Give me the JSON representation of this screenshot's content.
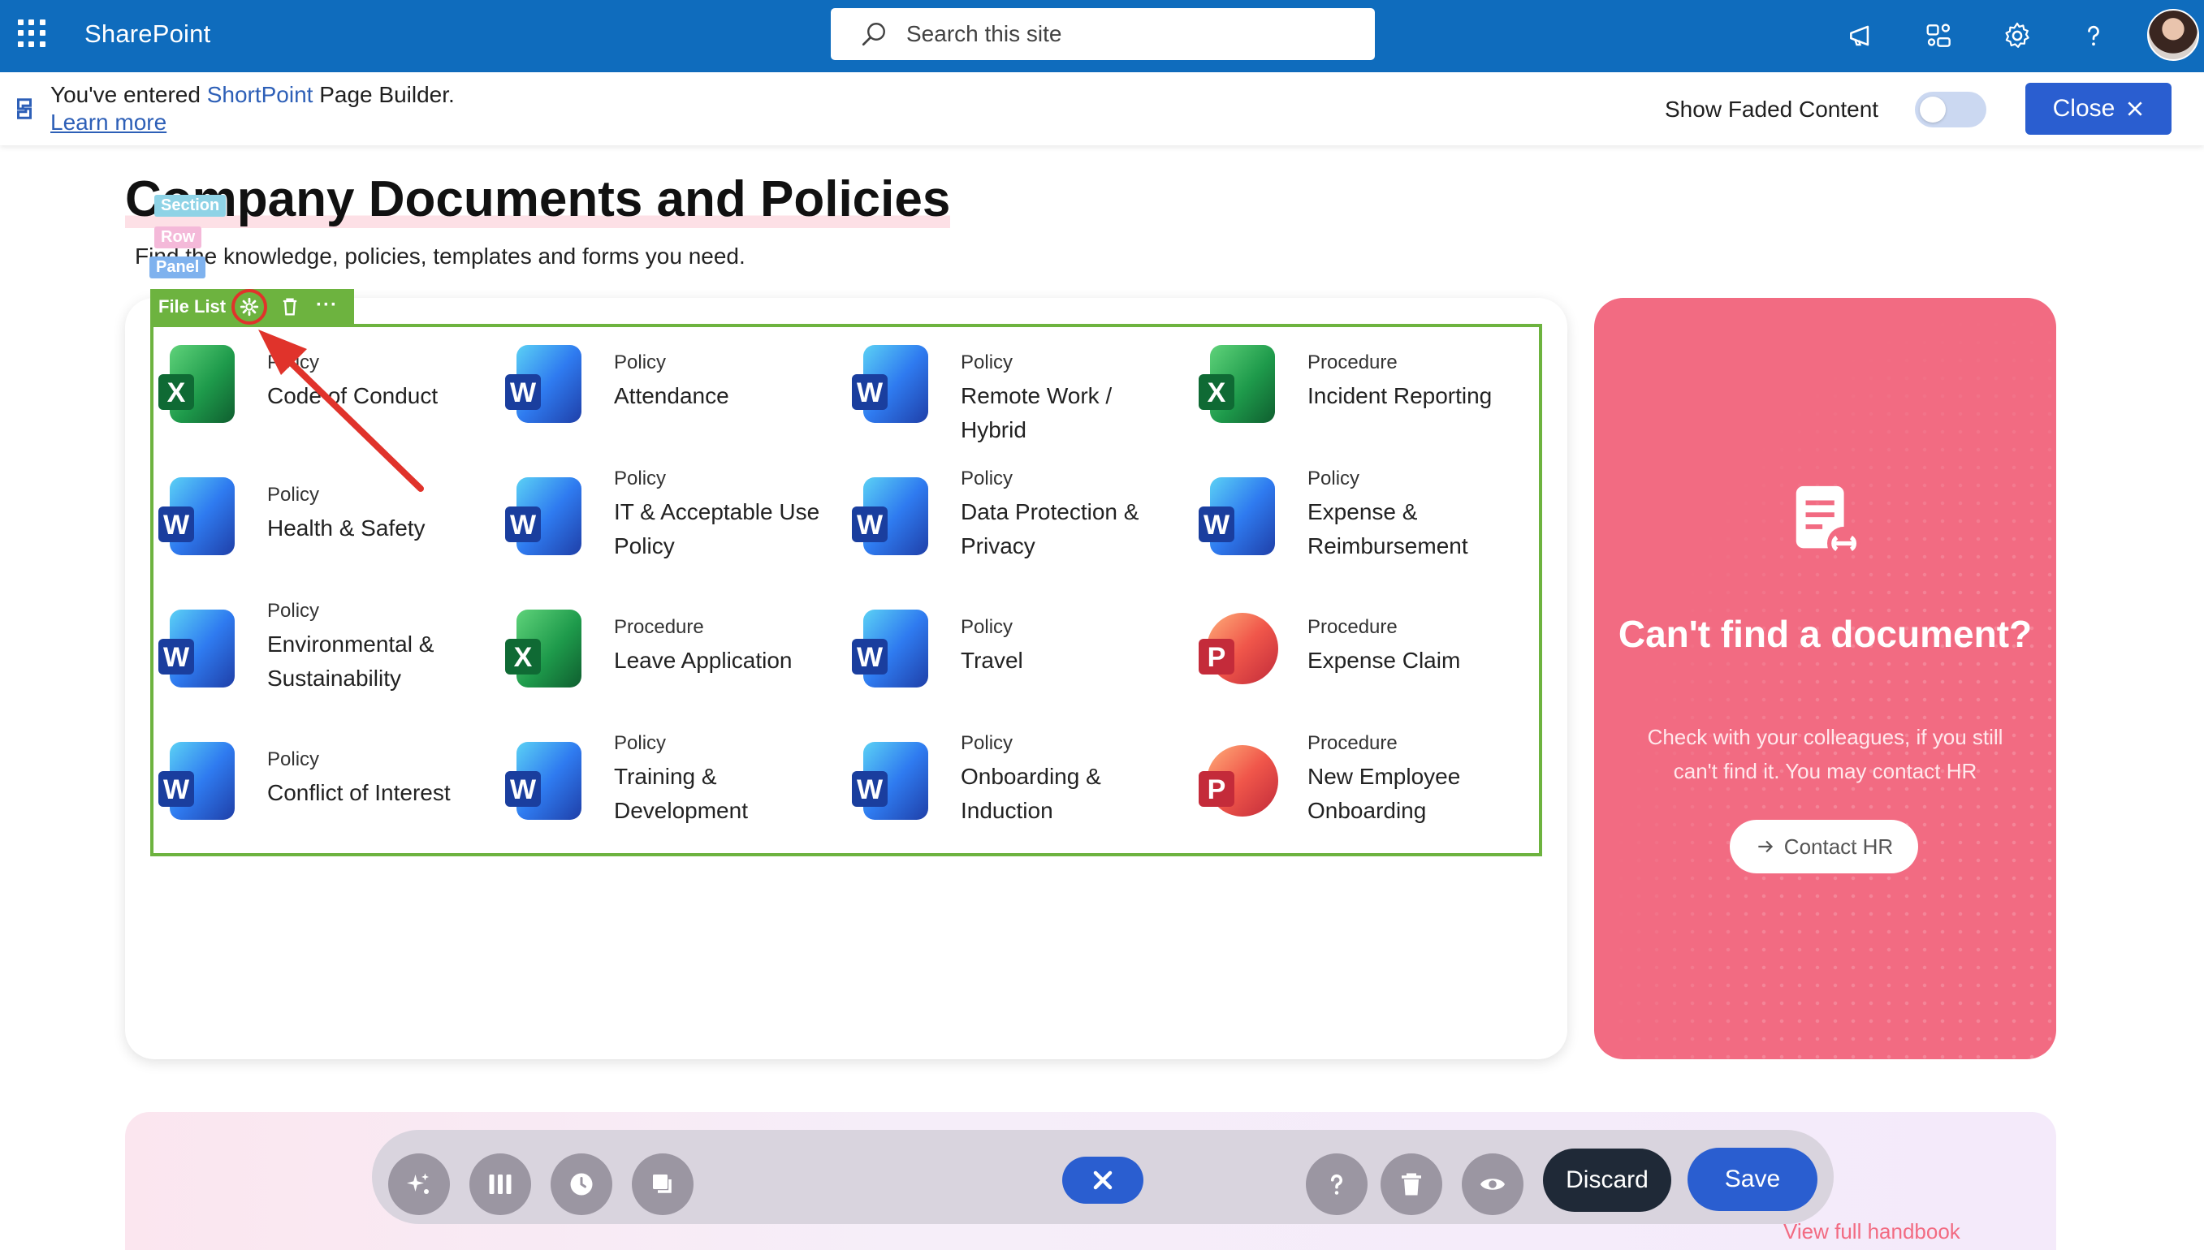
{
  "suite": {
    "app_name": "SharePoint",
    "search_placeholder": "Search this site"
  },
  "notice": {
    "prefix": "You've entered ",
    "product": "ShortPoint",
    "suffix": " Page Builder.",
    "learn_more": "Learn more",
    "faded_label": "Show Faded Content",
    "faded_on": false,
    "close_label": "Close"
  },
  "page": {
    "title": "Company Documents and Policies",
    "subtitle": "Find the knowledge, policies, templates and forms you need.",
    "chips": {
      "section": "Section",
      "row": "Row",
      "panel": "Panel"
    }
  },
  "file_list": {
    "toolbar_label": "File List",
    "documents": [
      {
        "category": "Policy",
        "name": "Code of Conduct",
        "type": "excel"
      },
      {
        "category": "Policy",
        "name": "Attendance",
        "type": "word"
      },
      {
        "category": "Policy",
        "name": "Remote Work / Hybrid",
        "type": "word"
      },
      {
        "category": "Procedure",
        "name": "Incident Reporting",
        "type": "excel"
      },
      {
        "category": "Policy",
        "name": "Health & Safety",
        "type": "word"
      },
      {
        "category": "Policy",
        "name": "IT & Acceptable Use Policy",
        "type": "word"
      },
      {
        "category": "Policy",
        "name": "Data Protection & Privacy",
        "type": "word"
      },
      {
        "category": "Policy",
        "name": "Expense & Reimbursement",
        "type": "word"
      },
      {
        "category": "Policy",
        "name": "Environmental & Sustainability",
        "type": "word"
      },
      {
        "category": "Procedure",
        "name": "Leave Application",
        "type": "excel"
      },
      {
        "category": "Policy",
        "name": "Travel",
        "type": "word"
      },
      {
        "category": "Procedure",
        "name": "Expense Claim",
        "type": "powerpoint"
      },
      {
        "category": "Policy",
        "name": "Conflict of Interest",
        "type": "word"
      },
      {
        "category": "Policy",
        "name": "Training & Development",
        "type": "word"
      },
      {
        "category": "Policy",
        "name": "Onboarding & Induction",
        "type": "word"
      },
      {
        "category": "Procedure",
        "name": "New Employee Onboarding",
        "type": "powerpoint"
      }
    ]
  },
  "side_panel": {
    "title": "Can't find a document?",
    "text": "Check with your colleagues, if you still can't find it. You may contact HR",
    "button": "Contact HR"
  },
  "lower": {
    "link": "View full handbook"
  },
  "bottom_bar": {
    "discard": "Discard",
    "save": "Save"
  },
  "colors": {
    "suite_bar": "#0f6cbd",
    "accent_blue": "#2a5ed0",
    "editor_green": "#6db33f",
    "side_pink": "#f26b82",
    "annotation_red": "#e0332b"
  }
}
